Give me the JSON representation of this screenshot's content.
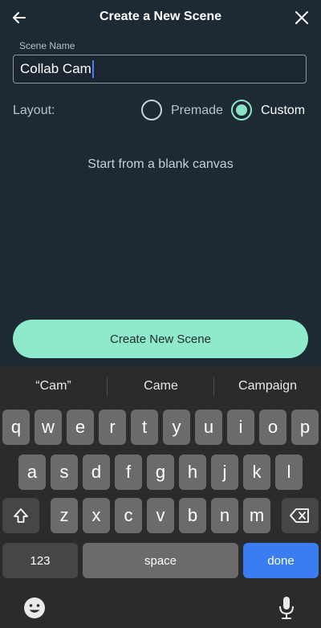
{
  "header": {
    "title": "Create a New Scene",
    "back_icon": "back-arrow-icon",
    "close_icon": "close-icon"
  },
  "form": {
    "scene_name_label": "Scene Name",
    "scene_name_value": "Collab Cam",
    "layout_label": "Layout:",
    "options": [
      {
        "label": "Premade",
        "selected": false
      },
      {
        "label": "Custom",
        "selected": true
      }
    ],
    "hint": "Start from a blank canvas",
    "accent_color": "#8ae3c7"
  },
  "create_button_label": "Create New Scene",
  "keyboard": {
    "suggestions": [
      "“Cam”",
      "Came",
      "Campaign"
    ],
    "row1": [
      "q",
      "w",
      "e",
      "r",
      "t",
      "y",
      "u",
      "i",
      "o",
      "p"
    ],
    "row2": [
      "a",
      "s",
      "d",
      "f",
      "g",
      "h",
      "j",
      "k",
      "l"
    ],
    "row3": [
      "z",
      "x",
      "c",
      "v",
      "b",
      "n",
      "m"
    ],
    "numbers_label": "123",
    "space_label": "space",
    "done_label": "done",
    "done_color": "#3a7df2"
  }
}
